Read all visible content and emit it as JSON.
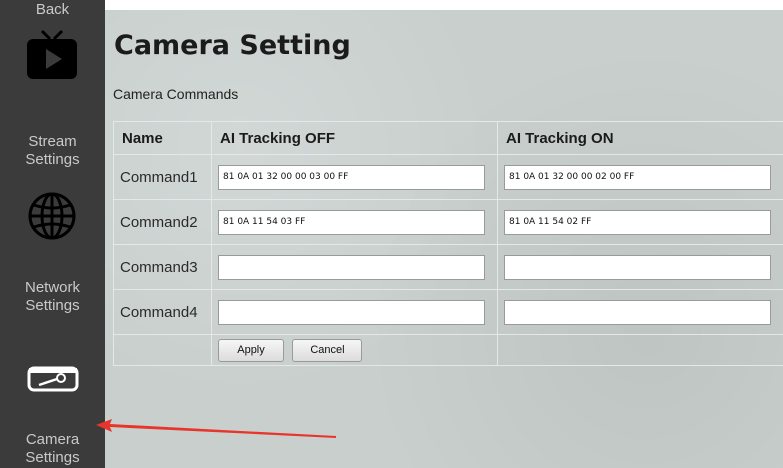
{
  "sidebar": {
    "back_label": "Back",
    "items": [
      {
        "label_line1": "Stream",
        "label_line2": "Settings",
        "icon": "tv-play-icon"
      },
      {
        "label_line1": "Network",
        "label_line2": "Settings",
        "icon": "globe-icon"
      },
      {
        "label_line1": "Camera",
        "label_line2": "Settings",
        "icon": "key-card-icon"
      }
    ]
  },
  "main": {
    "title": "Camera Setting",
    "section_title": "Camera Commands",
    "table": {
      "headers": [
        "Name",
        "AI Tracking OFF",
        "AI Tracking ON"
      ],
      "rows": [
        {
          "name": "Command1",
          "off": "81 0A 01 32 00 00 03 00 FF",
          "on": "81 0A 01 32 00 00 02 00 FF"
        },
        {
          "name": "Command2",
          "off": "81 0A 11 54 03 FF",
          "on": "81 0A 11 54 02 FF"
        },
        {
          "name": "Command3",
          "off": "",
          "on": ""
        },
        {
          "name": "Command4",
          "off": "",
          "on": ""
        }
      ]
    },
    "buttons": {
      "apply": "Apply",
      "cancel": "Cancel"
    }
  },
  "colors": {
    "sidebar_bg": "#3b3b3b",
    "main_bg": "#c8cfcd",
    "arrow": "#e8352b"
  }
}
